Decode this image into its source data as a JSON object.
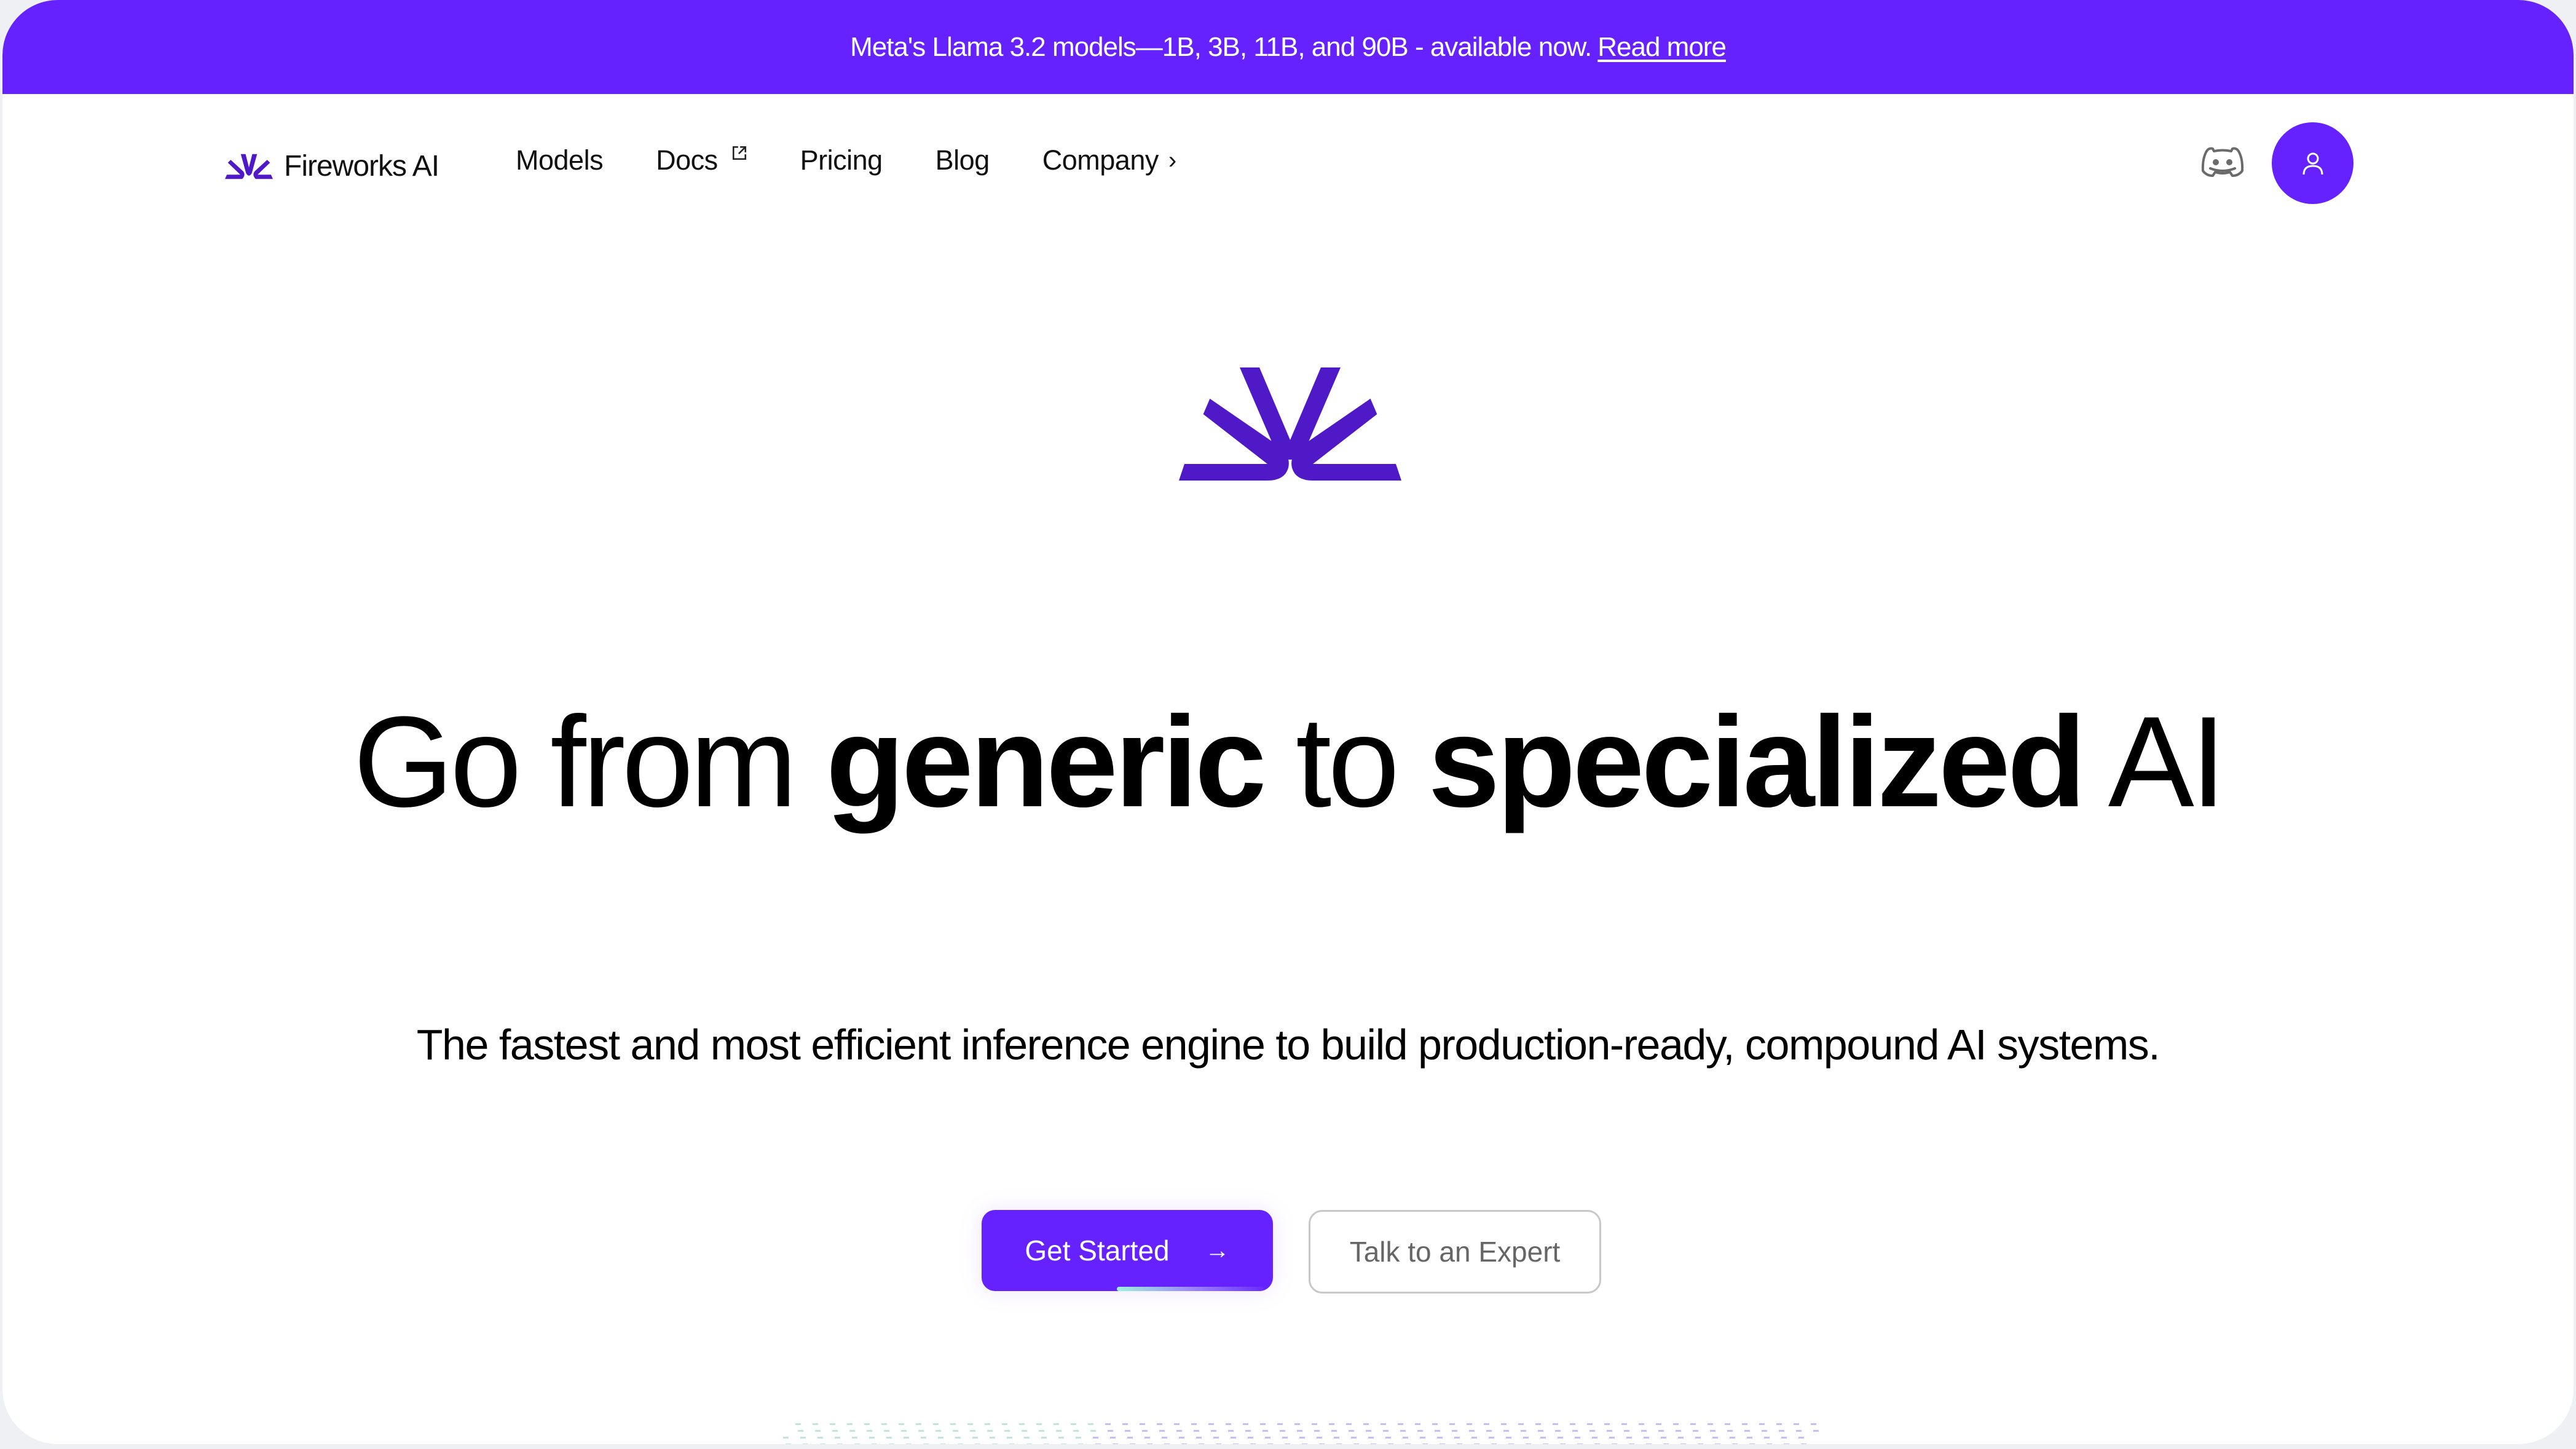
{
  "banner": {
    "text": "Meta's Llama 3.2 models—1B, 3B, 11B, and 90B - available now.",
    "link_label": "Read more"
  },
  "brand": {
    "name": "Fireworks AI",
    "accent_color": "#6522fe",
    "logo_color": "#5019c8"
  },
  "nav": {
    "items": [
      {
        "label": "Models",
        "icon": null
      },
      {
        "label": "Docs",
        "icon": "external-link-icon"
      },
      {
        "label": "Pricing",
        "icon": null
      },
      {
        "label": "Blog",
        "icon": null
      },
      {
        "label": "Company",
        "icon": "chevron-right-icon"
      }
    ],
    "discord_icon": "discord-icon",
    "user_icon": "user-icon"
  },
  "hero": {
    "headline": {
      "part1": "Go from ",
      "bold1": "generic",
      "part2": " to ",
      "bold2": "specialized",
      "part3": " AI"
    },
    "subheadline": "The fastest and most efficient inference engine to build production-ready, compound AI systems.",
    "primary_cta": "Get Started",
    "primary_cta_icon": "→",
    "secondary_cta": "Talk to an Expert"
  }
}
